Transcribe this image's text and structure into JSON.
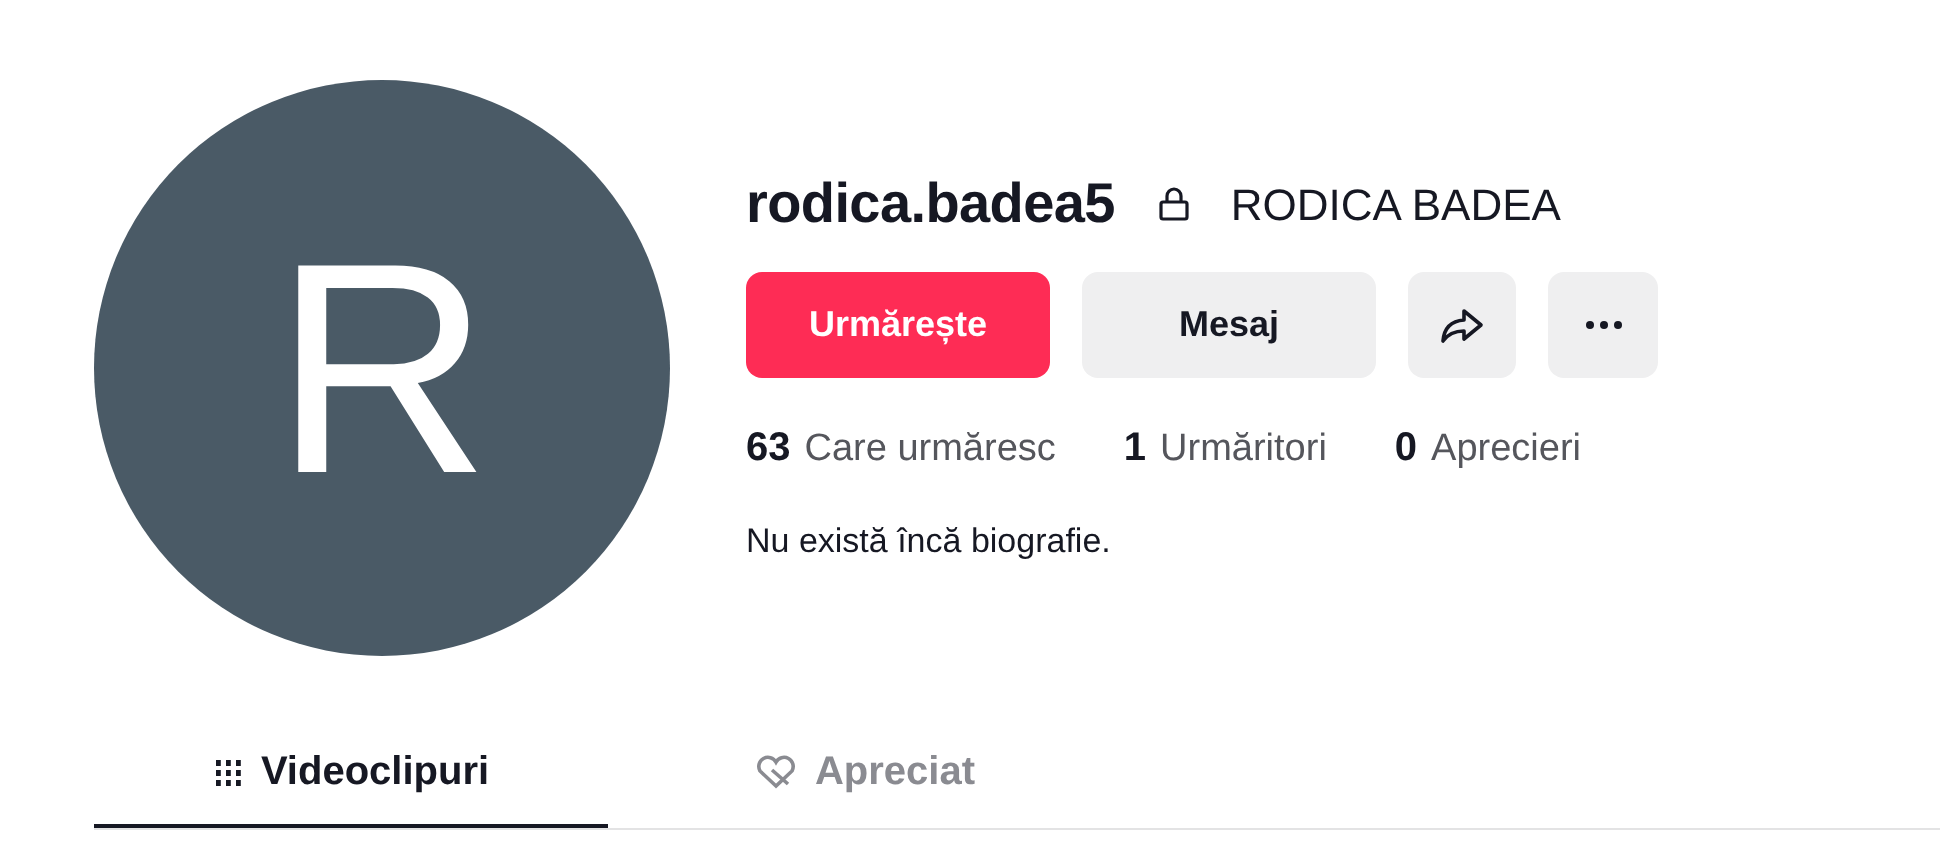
{
  "avatar": {
    "letter": "R"
  },
  "profile": {
    "username": "rodica.badea5",
    "display_name": "RODICA BADEA"
  },
  "buttons": {
    "follow": "Urmărește",
    "message": "Mesaj"
  },
  "stats": [
    {
      "count": "63",
      "suffix": "Care urmăresc"
    },
    {
      "count": "1",
      "suffix": "Urmăritori"
    },
    {
      "count": "0",
      "suffix": "Aprecieri"
    }
  ],
  "bio": "Nu există încă biografie.",
  "tabs": [
    {
      "label": "Videoclipuri",
      "kind": "videos",
      "selected": true
    },
    {
      "label": "Apreciat",
      "kind": "liked",
      "selected": false
    }
  ]
}
